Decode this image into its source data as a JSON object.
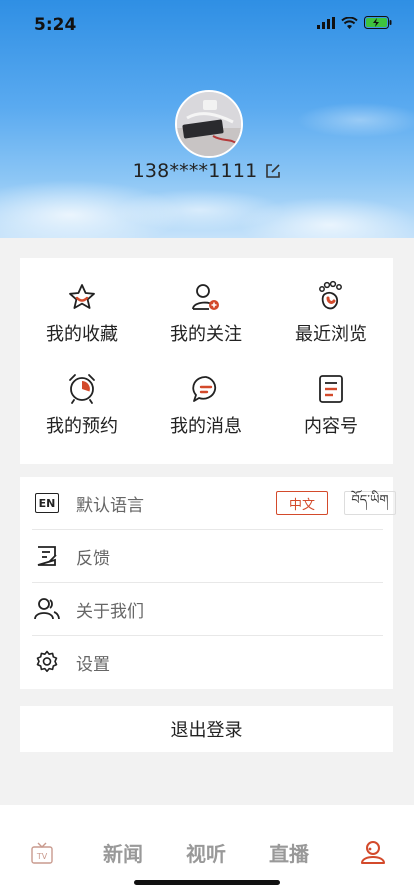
{
  "status": {
    "time": "5:24"
  },
  "profile": {
    "phone": "138****1111"
  },
  "grid": [
    {
      "label": "我的收藏",
      "icon": "star-icon"
    },
    {
      "label": "我的关注",
      "icon": "user-plus-icon"
    },
    {
      "label": "最近浏览",
      "icon": "footprint-icon"
    },
    {
      "label": "我的预约",
      "icon": "alarm-clock-icon"
    },
    {
      "label": "我的消息",
      "icon": "message-icon"
    },
    {
      "label": "内容号",
      "icon": "document-icon"
    }
  ],
  "settings": {
    "language": {
      "label": "默认语言",
      "icon_text": "EN",
      "options": [
        "中文",
        "བོད་ཡིག"
      ],
      "selected": "中文"
    },
    "feedback": {
      "label": "反馈"
    },
    "about": {
      "label": "关于我们"
    },
    "settings": {
      "label": "设置"
    }
  },
  "logout": {
    "label": "退出登录"
  },
  "tabs": [
    {
      "label": "TV",
      "icon": "tv-icon"
    },
    {
      "label": "新闻"
    },
    {
      "label": "视听"
    },
    {
      "label": "直播"
    },
    {
      "label": "",
      "icon": "profile-icon"
    }
  ],
  "colors": {
    "accent": "#d34a2b",
    "text": "#222222",
    "muted": "#999999"
  }
}
